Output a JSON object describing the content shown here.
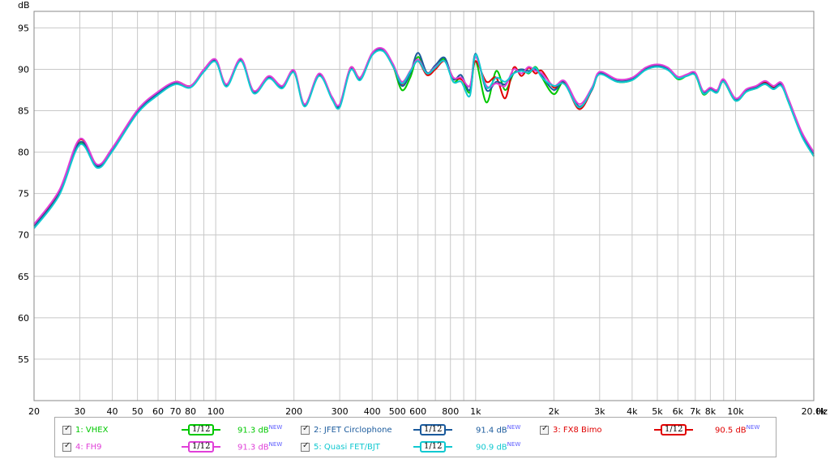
{
  "chart_data": {
    "type": "line",
    "xscale": "log",
    "xlim": [
      20,
      20000
    ],
    "ylim": [
      50,
      97
    ],
    "grid": true,
    "ylabel": "dB",
    "xunit": "Hz",
    "yticks": [
      55,
      60,
      65,
      70,
      75,
      80,
      85,
      90,
      95
    ],
    "xticks": [
      {
        "v": 20,
        "label": "20"
      },
      {
        "v": 30,
        "label": "30"
      },
      {
        "v": 40,
        "label": "40"
      },
      {
        "v": 50,
        "label": "50"
      },
      {
        "v": 60,
        "label": "60"
      },
      {
        "v": 70,
        "label": "70"
      },
      {
        "v": 80,
        "label": "80"
      },
      {
        "v": 100,
        "label": "100"
      },
      {
        "v": 200,
        "label": "200"
      },
      {
        "v": 300,
        "label": "300"
      },
      {
        "v": 400,
        "label": "400"
      },
      {
        "v": 500,
        "label": "500"
      },
      {
        "v": 600,
        "label": "600"
      },
      {
        "v": 800,
        "label": "800"
      },
      {
        "v": 1000,
        "label": "1k"
      },
      {
        "v": 2000,
        "label": "2k"
      },
      {
        "v": 3000,
        "label": "3k"
      },
      {
        "v": 4000,
        "label": "4k"
      },
      {
        "v": 5000,
        "label": "5k"
      },
      {
        "v": 6000,
        "label": "6k"
      },
      {
        "v": 7000,
        "label": "7k"
      },
      {
        "v": 8000,
        "label": "8k"
      },
      {
        "v": 10000,
        "label": "10k"
      },
      {
        "v": 20000,
        "label": "20.0k"
      }
    ],
    "x": [
      20,
      25,
      30,
      35,
      40,
      50,
      60,
      70,
      80,
      90,
      100,
      110,
      125,
      140,
      160,
      180,
      200,
      220,
      250,
      280,
      300,
      330,
      360,
      400,
      440,
      480,
      520,
      560,
      600,
      650,
      700,
      760,
      820,
      880,
      950,
      1000,
      1100,
      1200,
      1300,
      1400,
      1500,
      1600,
      1700,
      1800,
      2000,
      2200,
      2500,
      2800,
      3000,
      3500,
      4000,
      4500,
      5000,
      5500,
      6000,
      6500,
      7000,
      7500,
      8000,
      8500,
      9000,
      10000,
      11000,
      12000,
      13000,
      14000,
      15000,
      16000,
      18000,
      20000
    ],
    "series": [
      {
        "name": "1: VHEX",
        "color": "#00c800",
        "values": [
          71.0,
          75.0,
          81.0,
          78.2,
          80.2,
          84.8,
          87.0,
          88.3,
          87.9,
          89.8,
          91.0,
          88.0,
          91.1,
          87.2,
          89.0,
          87.8,
          89.7,
          85.6,
          89.3,
          86.5,
          85.5,
          90.0,
          88.8,
          91.8,
          92.4,
          90.5,
          87.5,
          89.0,
          91.5,
          89.5,
          90.3,
          91.2,
          88.5,
          89.0,
          87.2,
          91.0,
          86.0,
          89.8,
          87.5,
          89.5,
          90.0,
          89.5,
          90.3,
          89.0,
          87.0,
          88.5,
          85.5,
          87.5,
          89.5,
          88.5,
          88.7,
          90.0,
          90.3,
          90.0,
          88.8,
          89.2,
          89.3,
          87.0,
          87.5,
          87.2,
          88.5,
          86.2,
          87.3,
          87.7,
          88.2,
          87.6,
          88.1,
          86.0,
          82.0,
          79.5
        ]
      },
      {
        "name": "2: JFET Circlophone",
        "color": "#1a5a9c",
        "values": [
          71.0,
          75.0,
          81.2,
          78.3,
          80.3,
          84.9,
          87.1,
          88.4,
          88.0,
          89.9,
          91.1,
          88.1,
          91.2,
          87.3,
          89.1,
          87.9,
          89.8,
          85.7,
          89.4,
          86.6,
          85.6,
          90.1,
          88.9,
          91.9,
          92.4,
          90.6,
          88.0,
          89.5,
          92.0,
          89.6,
          90.5,
          91.4,
          88.8,
          89.3,
          87.5,
          91.9,
          87.5,
          88.5,
          88.2,
          89.5,
          90.0,
          89.8,
          90.0,
          89.2,
          87.5,
          88.5,
          85.5,
          87.5,
          89.5,
          88.6,
          88.8,
          90.1,
          90.4,
          90.1,
          89.0,
          89.3,
          89.4,
          87.2,
          87.6,
          87.3,
          88.6,
          86.3,
          87.4,
          87.8,
          88.3,
          87.7,
          88.2,
          86.2,
          82.2,
          79.8
        ]
      },
      {
        "name": "3: FX8 Bimo",
        "color": "#e00000",
        "values": [
          71.2,
          75.3,
          81.5,
          78.4,
          80.4,
          85.0,
          87.2,
          88.5,
          88.0,
          89.9,
          91.1,
          88.1,
          91.2,
          87.3,
          89.1,
          87.9,
          89.8,
          85.7,
          89.4,
          86.6,
          85.7,
          90.2,
          89.0,
          91.9,
          92.3,
          90.4,
          88.2,
          89.8,
          91.0,
          89.3,
          90.0,
          91.0,
          89.0,
          88.8,
          88.0,
          91.0,
          88.5,
          89.0,
          86.5,
          90.2,
          89.2,
          90.2,
          89.5,
          89.8,
          87.8,
          88.3,
          85.2,
          87.5,
          89.6,
          88.6,
          88.8,
          90.1,
          90.5,
          90.1,
          89.0,
          89.3,
          89.5,
          87.2,
          87.6,
          87.3,
          88.6,
          86.3,
          87.4,
          87.9,
          88.4,
          87.8,
          88.2,
          86.2,
          82.0,
          79.6
        ]
      },
      {
        "name": "4: FH9",
        "color": "#e040d8",
        "values": [
          71.3,
          75.4,
          81.6,
          78.5,
          80.5,
          85.1,
          87.3,
          88.5,
          88.0,
          90.0,
          91.2,
          88.2,
          91.3,
          87.4,
          89.2,
          88.0,
          89.9,
          85.8,
          89.5,
          86.7,
          85.8,
          90.2,
          89.0,
          92.0,
          92.5,
          90.7,
          88.5,
          89.8,
          91.2,
          89.5,
          90.3,
          91.0,
          89.0,
          89.0,
          88.0,
          91.5,
          88.0,
          88.3,
          88.0,
          90.0,
          89.5,
          90.3,
          89.8,
          89.5,
          88.0,
          88.6,
          85.8,
          87.8,
          89.7,
          88.8,
          89.0,
          90.2,
          90.6,
          90.2,
          89.1,
          89.4,
          89.6,
          87.4,
          87.8,
          87.5,
          88.8,
          86.5,
          87.6,
          88.0,
          88.6,
          88.0,
          88.4,
          86.4,
          82.4,
          80.0
        ]
      },
      {
        "name": "5: Quasi FET/BJT",
        "color": "#10c8d0",
        "values": [
          70.8,
          74.8,
          80.9,
          78.1,
          80.1,
          84.7,
          86.9,
          88.2,
          87.8,
          89.7,
          90.9,
          87.9,
          91.0,
          87.1,
          88.9,
          87.7,
          89.6,
          85.5,
          89.2,
          86.4,
          85.4,
          89.9,
          88.7,
          91.7,
          92.2,
          90.4,
          88.3,
          89.7,
          91.0,
          89.5,
          90.2,
          91.0,
          88.5,
          88.5,
          86.8,
          91.8,
          87.8,
          89.0,
          88.5,
          89.5,
          89.8,
          89.6,
          90.2,
          89.0,
          88.0,
          88.2,
          85.4,
          87.6,
          89.4,
          88.5,
          88.7,
          89.9,
          90.3,
          89.9,
          88.9,
          89.2,
          89.3,
          87.1,
          87.5,
          87.2,
          88.5,
          86.2,
          87.3,
          87.7,
          88.2,
          87.6,
          88.0,
          86.0,
          81.9,
          79.5
        ]
      }
    ]
  },
  "legend": {
    "items": [
      {
        "label": "1: VHEX",
        "color": "#00c800",
        "smoothing": "1/12",
        "level": "91.3 dB",
        "badge": "NEW"
      },
      {
        "label": "2: JFET Circlophone",
        "color": "#1a5a9c",
        "smoothing": "1/12",
        "level": "91.4 dB",
        "badge": "NEW"
      },
      {
        "label": "3: FX8 Bimo",
        "color": "#e00000",
        "smoothing": "1/12",
        "level": "90.5 dB",
        "badge": "NEW"
      },
      {
        "label": "4: FH9",
        "color": "#e040d8",
        "smoothing": "1/12",
        "level": "91.3 dB",
        "badge": "NEW"
      },
      {
        "label": "5: Quasi FET/BJT",
        "color": "#10c8d0",
        "smoothing": "1/12",
        "level": "90.9 dB",
        "badge": "NEW"
      }
    ]
  }
}
